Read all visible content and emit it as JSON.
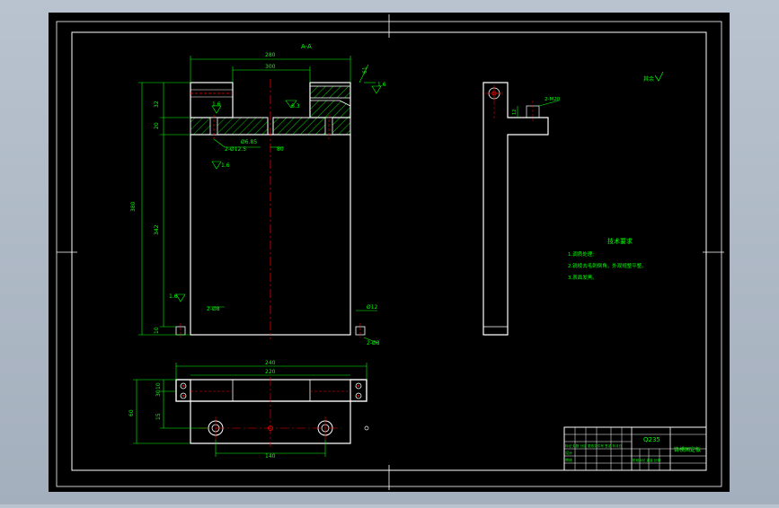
{
  "colors": {
    "viewport_bg": "#a9b3c1",
    "sheet_bg": "#000000",
    "border": "#ffffff",
    "dimension": "#00ff00",
    "centerline": "#ff0000",
    "hatch": "#00ff00",
    "text": "#ffffff"
  },
  "section_label": "A-A",
  "dimensions": {
    "overall_width": "280",
    "slot_width": "300",
    "overall_height": "380",
    "body_height": "342",
    "top_band": "32",
    "mid_band": "20",
    "bottom_band": "10",
    "top_right_note": "61",
    "hole_note_left": "2-Ø12.5",
    "hole_depth": "Ø6.85",
    "center_offset": "80",
    "bottom_hole_note": "2-Ø8",
    "bottom_tap": "Ø12",
    "bottom_tap_count": "2-Ø8",
    "side_hole_note": "2-M20",
    "side_gap": "12",
    "bottom_view_width": "240",
    "bottom_view_inner": "220",
    "bottom_view_height": "60",
    "bottom_view_band1": "10",
    "bottom_view_band2": "30",
    "bottom_view_band3": "15",
    "bottom_view_hole_spacing": "140"
  },
  "roughness": {
    "top_right": "1.6",
    "left_a": "1.6",
    "left_b": "6.3",
    "left_c": "1.6",
    "bottom_left": "1.6",
    "corner": "其余"
  },
  "notes": {
    "title": "技术要求",
    "items": [
      "1.调质处理;",
      "2.锐棱去毛刺倒角，外观规整平整。",
      "3.表面发黑。"
    ]
  },
  "title_block": {
    "material": "Q235",
    "part_name": "铸模固定板",
    "row_a": "标记 处数 分区 更改文件号 签名 年月日",
    "row_b": "设计",
    "row_c": "审核",
    "row_d": "阶段标记 重量 比例"
  }
}
